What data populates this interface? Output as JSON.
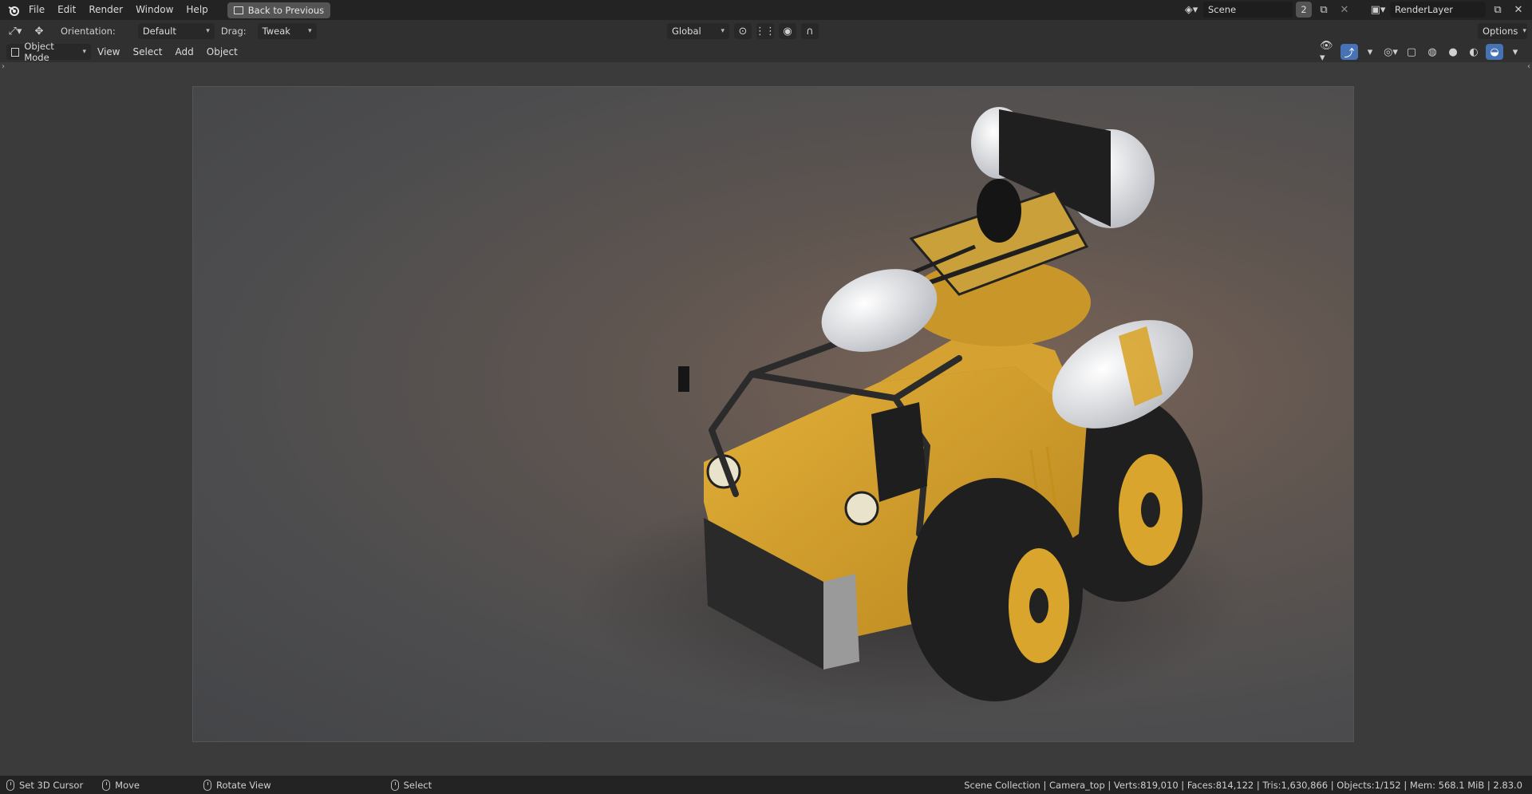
{
  "menu": {
    "items": [
      "File",
      "Edit",
      "Render",
      "Window",
      "Help"
    ],
    "back_button": "Back to Previous"
  },
  "scene": {
    "name": "Scene",
    "count": "2",
    "render_layer": "RenderLayer"
  },
  "toolbar": {
    "orientation_label": "Orientation:",
    "orientation_value": "Default",
    "drag_label": "Drag:",
    "drag_value": "Tweak",
    "transform_orientation": "Global",
    "options_label": "Options"
  },
  "header": {
    "mode": "Object Mode",
    "menus": [
      "View",
      "Select",
      "Add",
      "Object"
    ]
  },
  "viewport": {
    "content": "render-preview",
    "accent_color": "#4772b3"
  },
  "status": {
    "set_cursor": "Set 3D Cursor",
    "move": "Move",
    "rotate": "Rotate View",
    "select": "Select",
    "stats": "Scene Collection | Camera_top | Verts:819,010 | Faces:814,122 | Tris:1,630,866 | Objects:1/152 | Mem: 568.1 MiB | 2.83.0"
  }
}
